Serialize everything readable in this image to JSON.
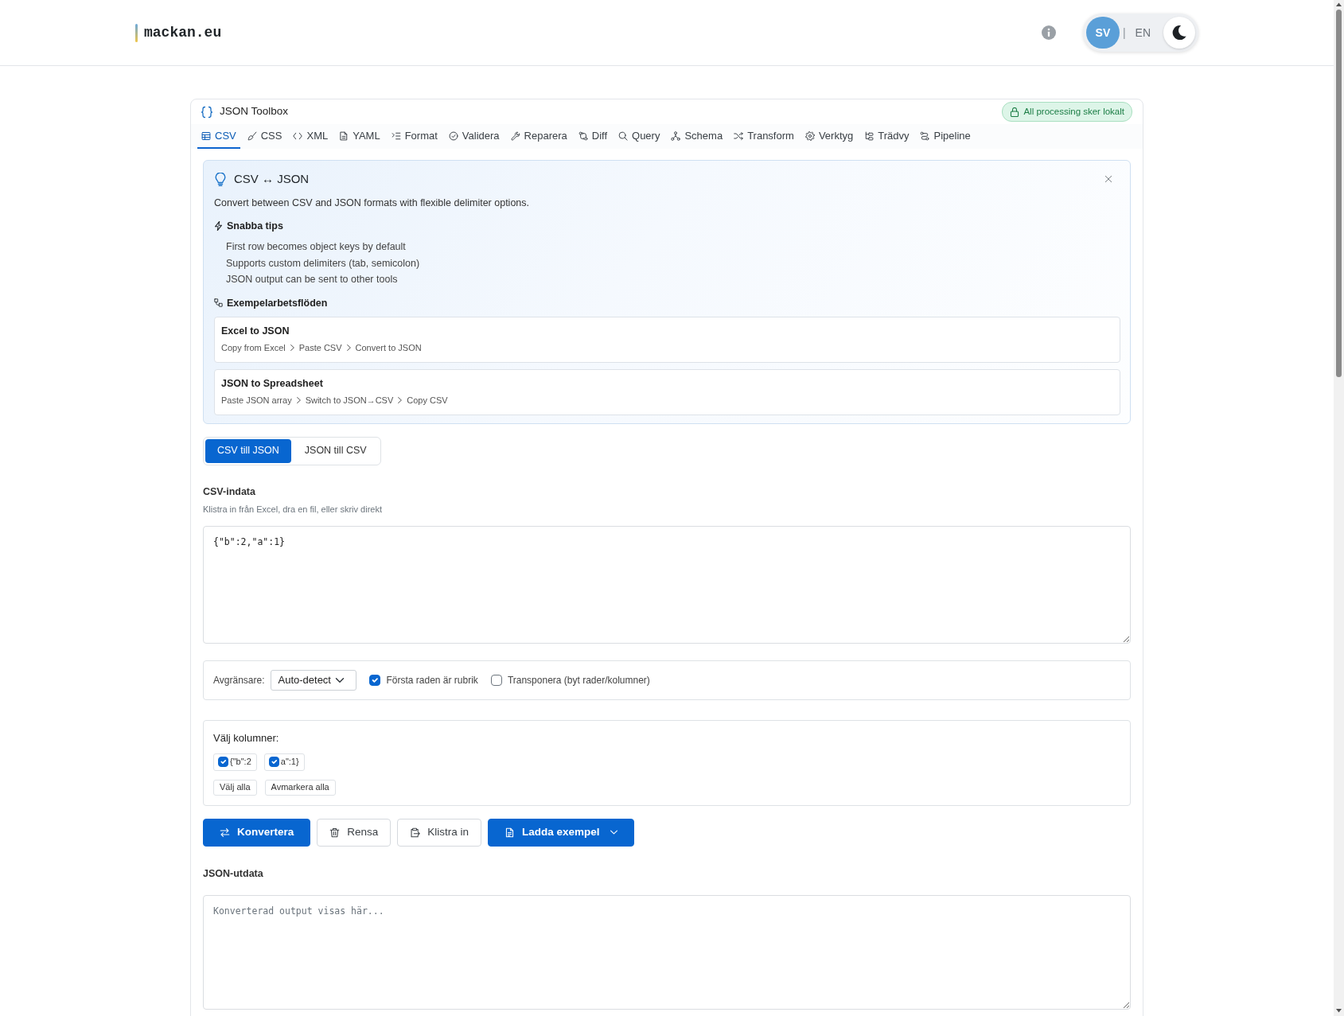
{
  "header": {
    "logo": "mackan.eu",
    "languages": [
      {
        "label": "SV",
        "selected": true
      },
      {
        "label": "EN",
        "selected": false
      }
    ],
    "language_separator": "|"
  },
  "toolbox": {
    "title": "JSON Toolbox",
    "badge": "All processing sker lokalt",
    "tabs": [
      {
        "label": "CSV",
        "selected": true
      },
      {
        "label": "CSS",
        "selected": false
      },
      {
        "label": "XML",
        "selected": false
      },
      {
        "label": "YAML",
        "selected": false
      },
      {
        "label": "Format",
        "selected": false
      },
      {
        "label": "Validera",
        "selected": false
      },
      {
        "label": "Reparera",
        "selected": false
      },
      {
        "label": "Diff",
        "selected": false
      },
      {
        "label": "Query",
        "selected": false
      },
      {
        "label": "Schema",
        "selected": false
      },
      {
        "label": "Transform",
        "selected": false
      },
      {
        "label": "Verktyg",
        "selected": false
      },
      {
        "label": "Trädvy",
        "selected": false
      },
      {
        "label": "Pipeline",
        "selected": false
      }
    ],
    "info": {
      "title": "CSV ↔ JSON",
      "description": "Convert between CSV and JSON formats with flexible delimiter options.",
      "tips_heading": "Snabba tips",
      "tips": [
        "First row becomes object keys by default",
        "Supports custom delimiters (tab, semicolon)",
        "JSON output can be sent to other tools"
      ],
      "workflows_heading": "Exempelarbetsflöden",
      "workflows": [
        {
          "title": "Excel to JSON",
          "steps": [
            "Copy from Excel",
            "Paste CSV",
            "Convert to JSON"
          ]
        },
        {
          "title": "JSON to Spreadsheet",
          "steps": [
            "Paste JSON array",
            "Switch to JSON→CSV",
            "Copy CSV"
          ]
        }
      ]
    },
    "modes": [
      {
        "label": "CSV till JSON",
        "selected": true
      },
      {
        "label": "JSON till CSV",
        "selected": false
      }
    ],
    "input": {
      "label": "CSV-indata",
      "hint": "Klistra in från Excel, dra en fil, eller skriv direkt",
      "value": "{\"b\":2,\"a\":1}"
    },
    "options": {
      "delimiter_label": "Avgränsare:",
      "delimiter_value": "Auto-detect",
      "checkboxes": [
        {
          "label": "Första raden är rubrik",
          "checked": true
        },
        {
          "label": "Transponera (byt rader/kolumner)",
          "checked": false
        }
      ]
    },
    "columns": {
      "label": "Välj kolumner:",
      "items": [
        {
          "label": "{\"b\":2",
          "checked": true
        },
        {
          "label": "a\":1}",
          "checked": true
        }
      ],
      "buttons": [
        "Välj alla",
        "Avmarkera alla"
      ]
    },
    "actions": [
      {
        "label": "Konvertera",
        "kind": "primary"
      },
      {
        "label": "Rensa",
        "kind": "secondary"
      },
      {
        "label": "Klistra in",
        "kind": "secondary"
      },
      {
        "label": "Ladda exempel",
        "kind": "dropdown"
      }
    ],
    "output": {
      "label": "JSON-utdata",
      "placeholder": "Konverterad output visas här..."
    }
  }
}
